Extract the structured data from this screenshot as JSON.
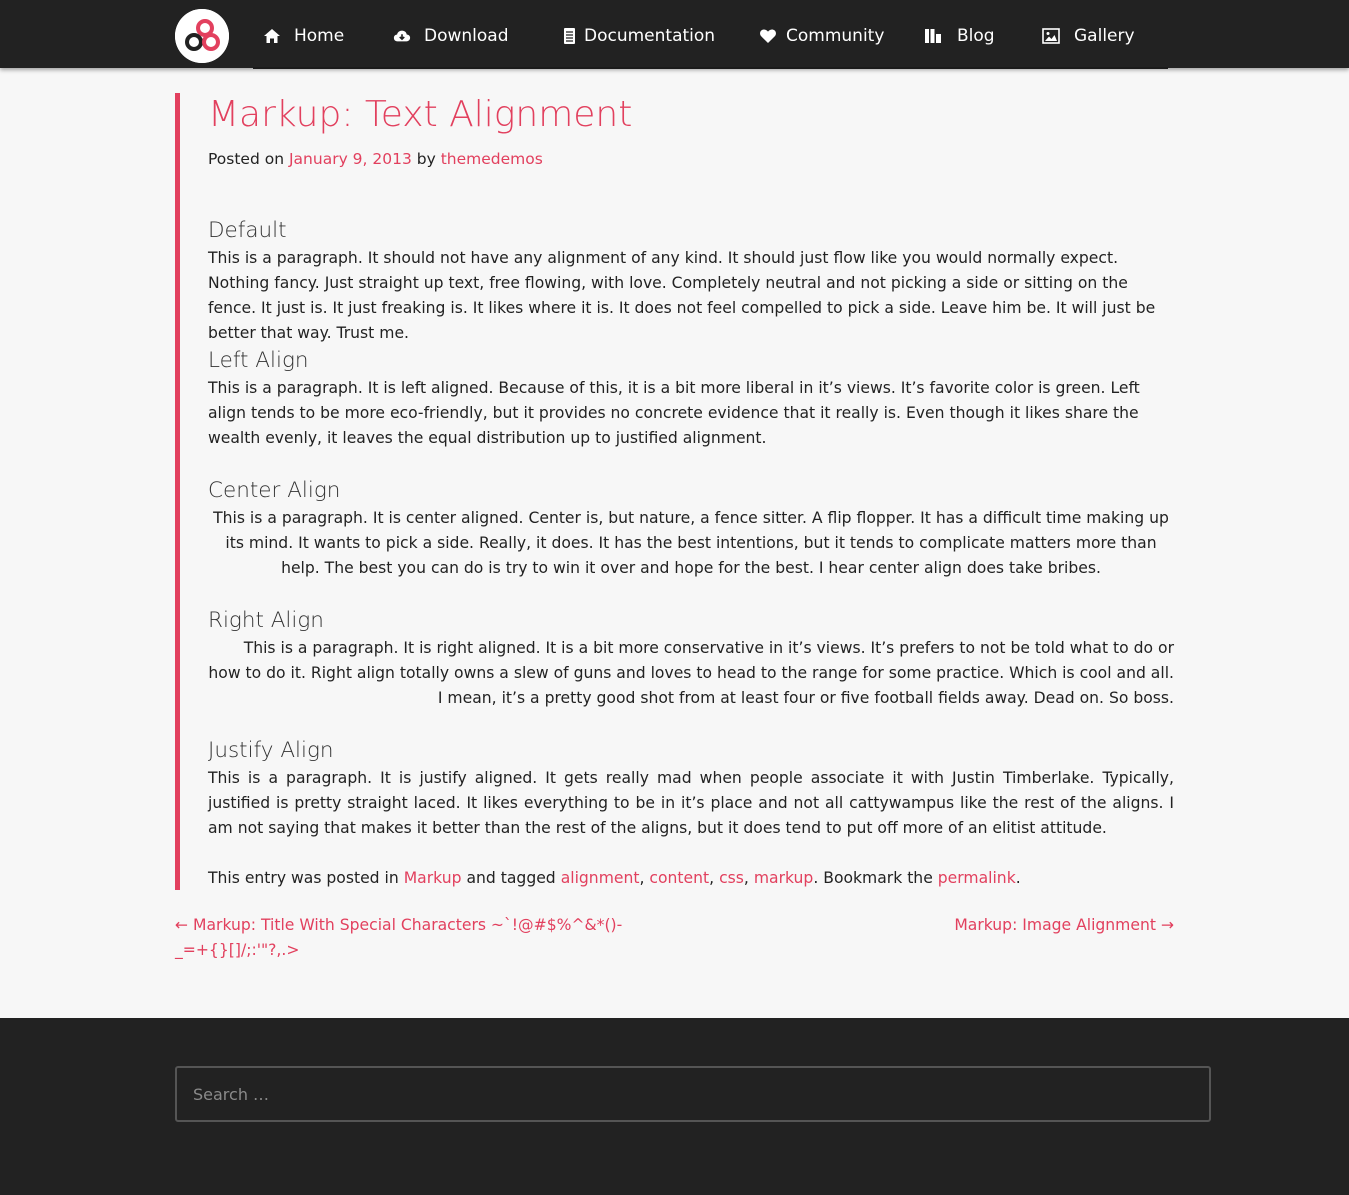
{
  "nav": {
    "items": [
      {
        "label": "Home",
        "icon": "home-icon"
      },
      {
        "label": "Download",
        "icon": "cloud-download-icon"
      },
      {
        "label": "Documentation",
        "icon": "document-icon"
      },
      {
        "label": "Community",
        "icon": "heart-icon"
      },
      {
        "label": "Blog",
        "icon": "book-icon"
      },
      {
        "label": "Gallery",
        "icon": "image-icon"
      }
    ]
  },
  "colors": {
    "accent": "#e2405e",
    "nav_bg": "#222222",
    "page_bg": "#f7f7f7"
  },
  "post": {
    "title": "Markup: Text Alignment",
    "posted_on": "Posted on",
    "date": "January 9, 2013",
    "by": "by",
    "author": "themedemos",
    "sections": [
      {
        "heading": "Default",
        "text": "This is a paragraph. It should not have any alignment of any kind. It should just flow like you would normally expect. Nothing fancy. Just straight up text, free flowing, with love. Completely neutral and not picking a side or sitting on the fence. It just is. It just freaking is. It likes where it is. It does not feel compelled to pick a side. Leave him be. It will just be better that way. Trust me."
      },
      {
        "heading": "Left Align",
        "text": "This is a paragraph. It is left aligned. Because of this, it is a bit more liberal in it’s views. It’s favorite color is green. Left align tends to be more eco-friendly, but it provides no concrete evidence that it really is. Even though it likes share the wealth evenly, it leaves the equal distribution up to justified alignment."
      },
      {
        "heading": "Center Align",
        "text": "This is a paragraph. It is center aligned. Center is, but nature, a fence sitter. A flip flopper. It has a difficult time making up its mind. It wants to pick a side. Really, it does. It has the best intentions, but it tends to complicate matters more than help. The best you can do is try to win it over and hope for the best. I hear center align does take bribes."
      },
      {
        "heading": "Right Align",
        "text": "This is a paragraph. It is right aligned. It is a bit more conservative in it’s views. It’s prefers to not be told what to do or how to do it. Right align totally owns a slew of guns and loves to head to the range for some practice. Which is cool and all. I mean, it’s a pretty good shot from at least four or five football fields away. Dead on. So boss."
      },
      {
        "heading": "Justify Align",
        "text": "This is a paragraph. It is justify aligned. It gets really mad when people associate it with Justin Timberlake. Typically, justified is pretty straight laced. It likes everything to be in it’s place and not all cattywampus like the rest of the aligns. I am not saying that makes it better than the rest of the aligns, but it does tend to put off more of an elitist attitude."
      }
    ],
    "entry_footer": {
      "prefix": "This entry was posted in",
      "category": "Markup",
      "tagged": "and tagged",
      "tags": [
        "alignment",
        "content",
        "css",
        "markup"
      ],
      "comma": ",",
      "bookmark": ". Bookmark the",
      "permalink": "permalink",
      "end": "."
    }
  },
  "post_nav": {
    "prev": "← Markup: Title With Special Characters ~`!@#$%^&*()-_=+{}[]/;:'\"?,.>",
    "next": "Markup: Image Alignment →"
  },
  "footer": {
    "search_placeholder": "Search …"
  }
}
